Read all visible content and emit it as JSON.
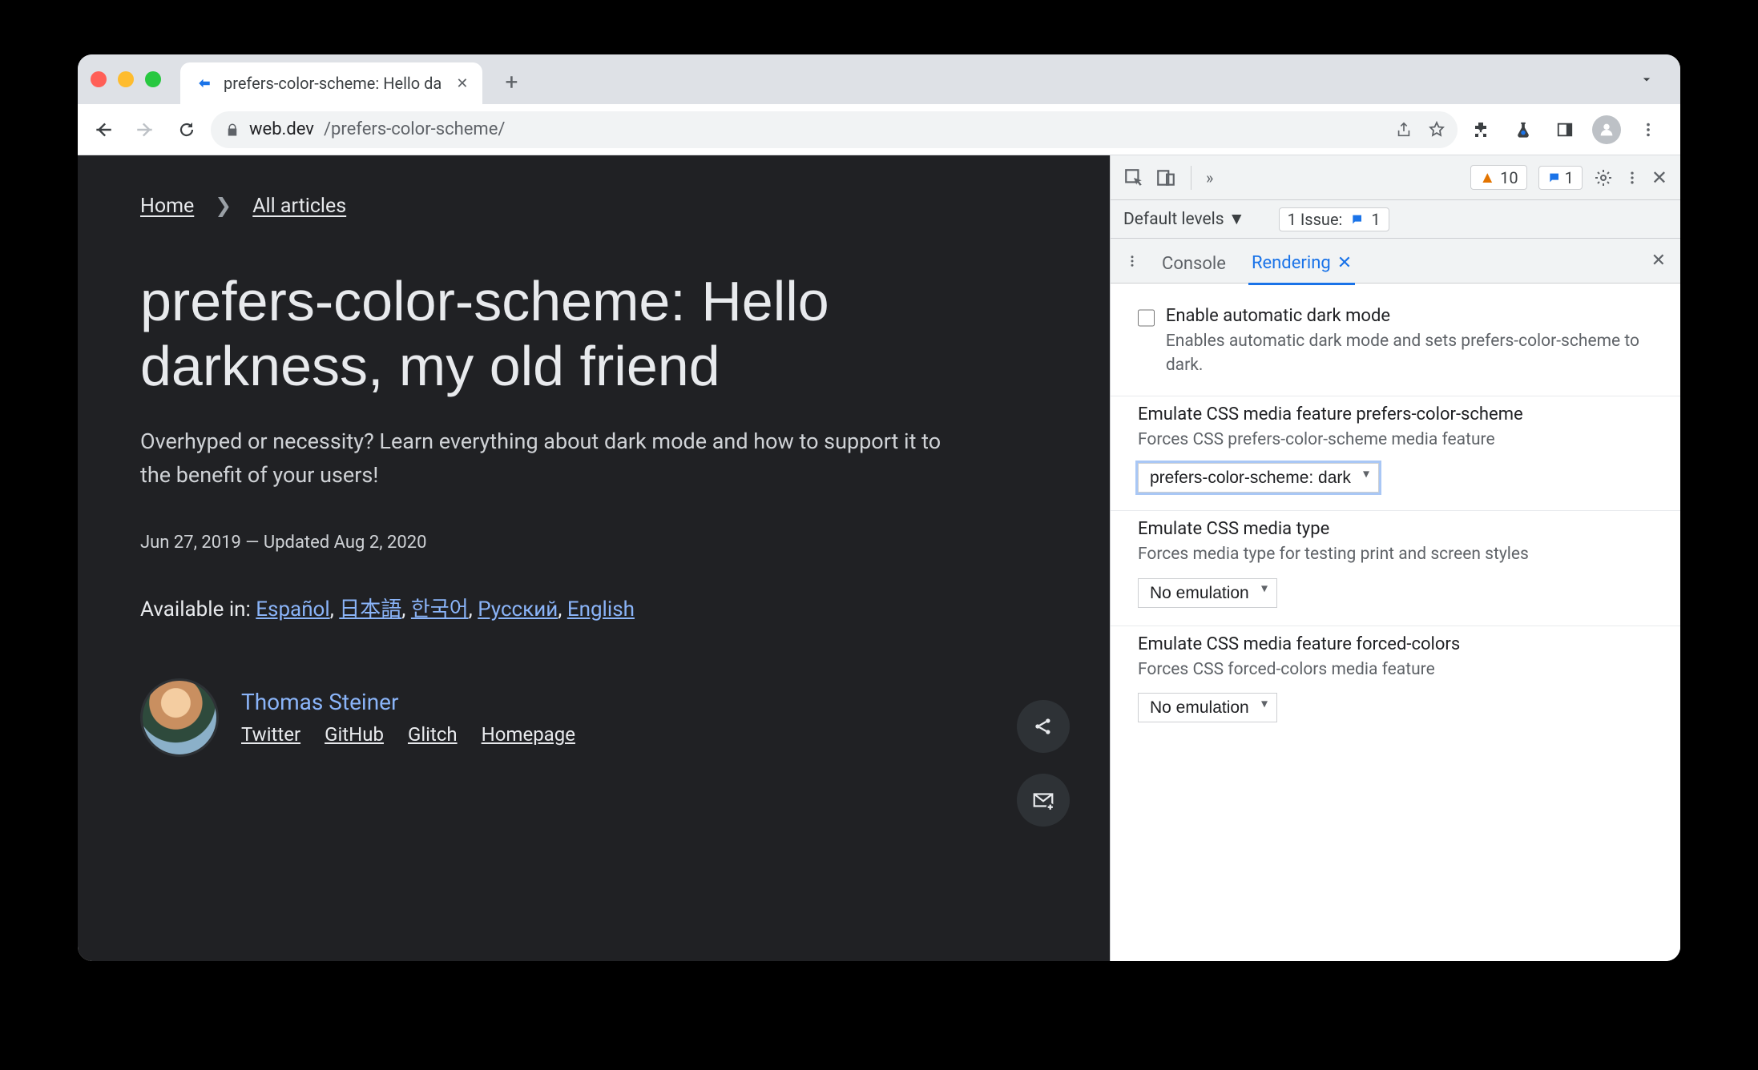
{
  "window": {
    "tab_title": "prefers-color-scheme: Hello da",
    "url_host": "web.dev",
    "url_path": "/prefers-color-scheme/"
  },
  "toolbar": {
    "warnings_count": "10",
    "messages_count": "1"
  },
  "devtools": {
    "levels_label": "Default levels",
    "issue_prefix": "1 Issue:",
    "issue_count": "1",
    "tabs": {
      "console": "Console",
      "rendering": "Rendering"
    },
    "rend": {
      "dark_title": "Enable automatic dark mode",
      "dark_desc": "Enables automatic dark mode and sets prefers-color-scheme to dark.",
      "pcs_title": "Emulate CSS media feature prefers-color-scheme",
      "pcs_desc": "Forces CSS prefers-color-scheme media feature",
      "pcs_value": "prefers-color-scheme: dark",
      "media_title": "Emulate CSS media type",
      "media_desc": "Forces media type for testing print and screen styles",
      "media_value": "No emulation",
      "forced_title": "Emulate CSS media feature forced-colors",
      "forced_desc": "Forces CSS forced-colors media feature",
      "forced_value": "No emulation"
    }
  },
  "page": {
    "crumbs": {
      "home": "Home",
      "all": "All articles"
    },
    "h1": "prefers-color-scheme: Hello darkness, my old friend",
    "subtitle": "Overhyped or necessity? Learn everything about dark mode and how to support it to the benefit of your users!",
    "meta": "Jun 27, 2019 — Updated Aug 2, 2020",
    "langs_label": "Available in: ",
    "langs": {
      "es": "Español",
      "ja": "日本語",
      "ko": "한국어",
      "ru": "Русский",
      "en": "English"
    },
    "author": {
      "name": "Thomas Steiner",
      "links": {
        "tw": "Twitter",
        "gh": "GitHub",
        "gl": "Glitch",
        "hp": "Homepage"
      }
    }
  }
}
